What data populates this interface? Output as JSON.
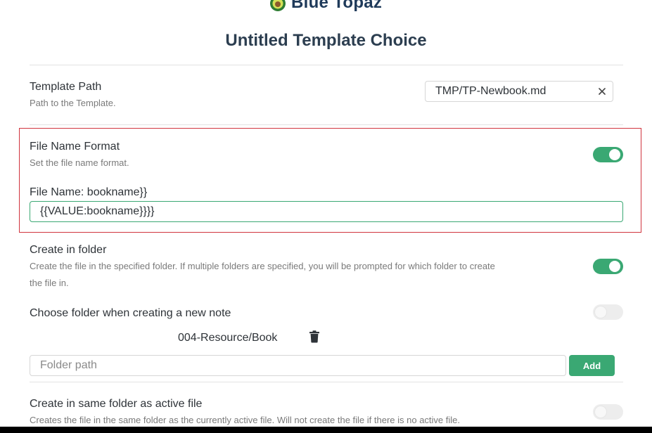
{
  "brand": {
    "name": "Blue Topaz"
  },
  "modal": {
    "title": "Untitled Template Choice"
  },
  "template_path": {
    "name": "Template Path",
    "desc": "Path to the Template.",
    "value": "TMP/TP-Newbook.md",
    "clear_icon": "close-icon"
  },
  "file_name_format": {
    "name": "File Name Format",
    "desc": "Set the file name format.",
    "enabled": true,
    "preview_label": "File Name: bookname}}",
    "value": "{{VALUE:bookname}}}}"
  },
  "create_in_folder": {
    "name": "Create in folder",
    "desc_line1": "Create the file in the specified folder. If multiple folders are specified, you will be prompted for which folder to create",
    "desc_line2": "the file in.",
    "enabled": true
  },
  "choose_folder": {
    "name": "Choose folder when creating a new note",
    "enabled": false,
    "folders": [
      "004-Resource/Book"
    ],
    "delete_icon": "trash-icon",
    "placeholder": "Folder path",
    "add_label": "Add"
  },
  "same_folder": {
    "name": "Create in same folder as active file",
    "desc": "Creates the file in the same folder as the currently active file. Will not create the file if there is no active file.",
    "enabled": false
  },
  "colors": {
    "accent": "#3aa873",
    "highlight": "#d1343e",
    "title": "#2c3e50"
  }
}
